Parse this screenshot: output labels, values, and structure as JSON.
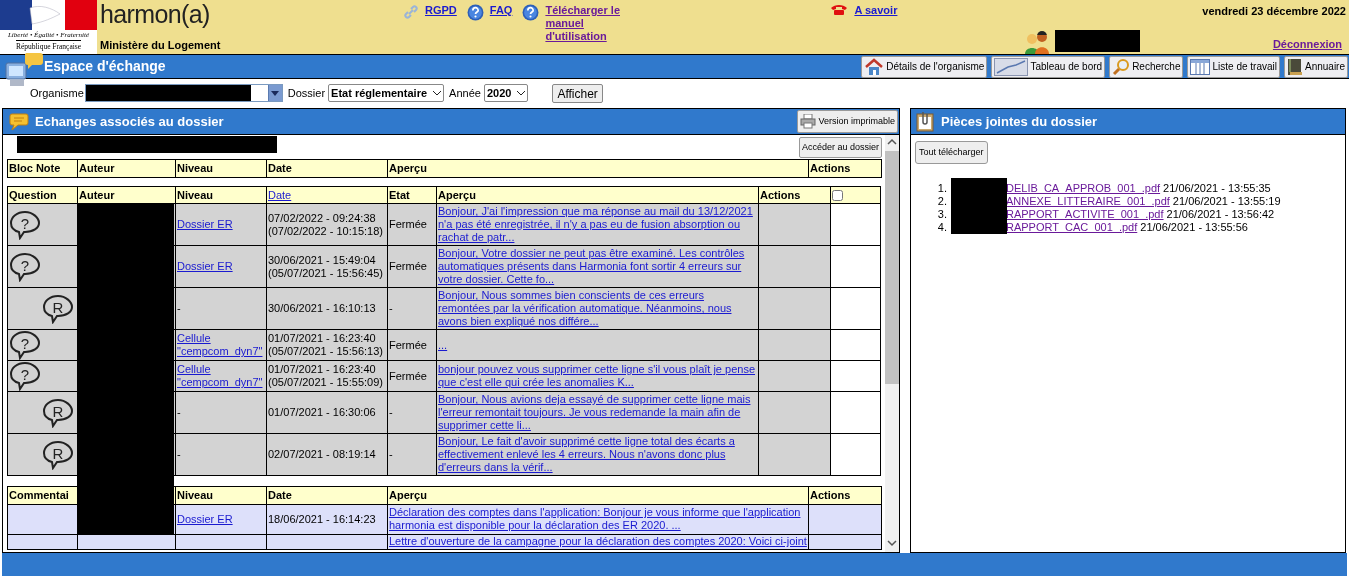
{
  "header": {
    "republic_motto": "Liberté • Égalité • Fraternité",
    "republic_name": "République Française",
    "logo": "harmon(a)",
    "ministry": "Ministère du Logement",
    "links": [
      {
        "kind": "link",
        "label": "RGPD"
      },
      {
        "kind": "help",
        "label": "FAQ"
      },
      {
        "kind": "help",
        "label": "Télécharger le manuel d'utilisation"
      },
      {
        "kind": "phone",
        "label": "A savoir"
      }
    ],
    "date": "vendredi 23 décembre 2022",
    "logout": "Déconnexion"
  },
  "title_bar": {
    "title": "Espace d'échange",
    "buttons": [
      {
        "kind": "house",
        "label": "Détails de l'organisme"
      },
      {
        "kind": "chart",
        "label": "Tableau de bord"
      },
      {
        "kind": "search",
        "label": "Recherche"
      },
      {
        "kind": "list",
        "label": "Liste de travail"
      },
      {
        "kind": "book",
        "label": "Annuaire"
      }
    ]
  },
  "filters": {
    "organisme_label": "Organisme",
    "dossier_label": "Dossier",
    "dossier_value": "Etat réglementaire",
    "annee_label": "Année",
    "annee_value": "2020",
    "submit": "Afficher"
  },
  "exchanges": {
    "title": "Echanges associés au dossier",
    "print_button": "Version imprimable",
    "open_button": "Accéder au dossier",
    "notes_columns": [
      "Bloc Note",
      "Auteur",
      "Niveau",
      "Date",
      "Aperçu",
      "Actions"
    ],
    "question_columns": [
      "Question",
      "Auteur",
      "Niveau",
      "Date",
      "Etat",
      "Aperçu",
      "Actions"
    ],
    "select_all_checked": false,
    "rows": [
      {
        "kind": "question",
        "mark": "?",
        "niveau": "Dossier ER",
        "date": "07/02/2022 - 09:24:38",
        "date2": "(07/02/2022 - 10:15:18)",
        "etat": "Fermée",
        "apercu": "Bonjour, J'ai l'impression que ma réponse au mail du 13/12/2021 n'a pas été enregistrée, il n'y a pas eu de fusion absorption ou rachat de patr..."
      },
      {
        "kind": "question",
        "mark": "?",
        "niveau": "Dossier ER",
        "date": "30/06/2021 - 15:49:04",
        "date2": "(05/07/2021 - 15:56:45)",
        "etat": "Fermée",
        "apercu": "Bonjour, Votre dossier ne peut pas être examiné. Les contrôles automatiques présents dans Harmonia font sortir 4 erreurs sur votre dossier. Cette fo..."
      },
      {
        "kind": "reply",
        "mark": "R",
        "niveau": "-",
        "date": "30/06/2021 - 16:10:13",
        "etat": "-",
        "apercu": "Bonjour, Nous sommes bien conscients de ces erreurs remontées par la vérification automatique. Néanmoins, nous avons bien expliqué nos différe..."
      },
      {
        "kind": "question",
        "mark": "?",
        "niveau": "Cellule \"cempcom_dyn7\"",
        "date": "01/07/2021 - 16:23:40",
        "date2": "(05/07/2021 - 15:56:13)",
        "etat": "Fermée",
        "apercu": "..."
      },
      {
        "kind": "question",
        "mark": "?",
        "niveau": "Cellule \"cempcom_dyn7\"",
        "date": "01/07/2021 - 16:23:40",
        "date2": "(05/07/2021 - 15:55:09)",
        "etat": "Fermée",
        "apercu": "bonjour pouvez vous supprimer cette ligne s'il vous plaît je pense que c'est elle qui crée les anomalies K..."
      },
      {
        "kind": "reply",
        "mark": "R",
        "niveau": "-",
        "date": "01/07/2021 - 16:30:06",
        "etat": "-",
        "apercu": "Bonjour, Nous avions deja essayé de supprimer cette ligne mais l'erreur remontait toujours. Je vous redemande la main afin de supprimer cette li..."
      },
      {
        "kind": "reply",
        "mark": "R",
        "niveau": "-",
        "date": "02/07/2021 - 08:19:14",
        "etat": "-",
        "apercu": "Bonjour, Le fait d'avoir supprimé cette ligne total des écarts a effectivement enlevé les 4 erreurs. Nous n'avons donc plus d'erreurs dans la vérif..."
      }
    ],
    "comment_columns": [
      "Commentai",
      "Niveau",
      "Date",
      "Aperçu",
      "Actions"
    ],
    "comments": [
      {
        "niveau": "Dossier ER",
        "date": "18/06/2021 - 16:14:23",
        "apercu": "Déclaration des comptes dans l'application: Bonjour je vous informe que l'application harmonia est disponible pour la déclaration des ER 2020. ..."
      },
      {
        "apercu": "Lettre d'ouverture de la campagne pour la déclaration des comptes 2020: Voici ci-joint"
      }
    ]
  },
  "attachments": {
    "title": "Pièces jointes du dossier",
    "download_all": "Tout télécharger",
    "files": [
      {
        "number": "1.",
        "name": "DELIB_CA_APPROB_001_.pdf",
        "date": "21/06/2021 - 13:55:35"
      },
      {
        "number": "2.",
        "name": "ANNEXE_LITTERAIRE_001_.pdf",
        "date": "21/06/2021 - 13:55:19"
      },
      {
        "number": "3.",
        "name": "RAPPORT_ACTIVITE_001_.pdf",
        "date": "21/06/2021 - 13:56:42"
      },
      {
        "number": "4.",
        "name": "RAPPORT_CAC_001_.pdf",
        "date": "21/06/2021 - 13:55:56"
      }
    ]
  }
}
